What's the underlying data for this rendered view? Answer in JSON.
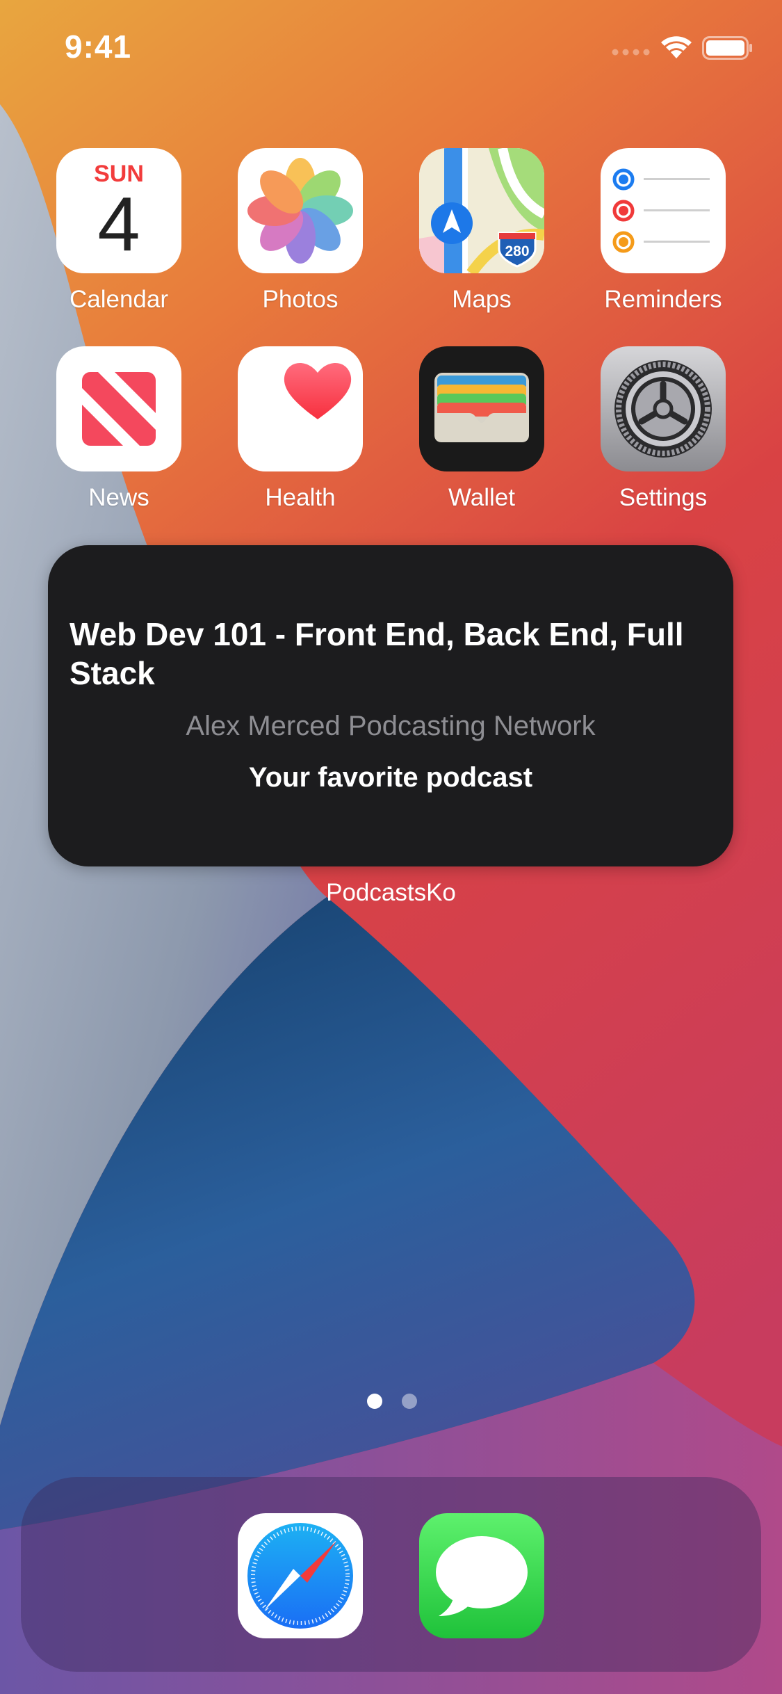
{
  "status_bar": {
    "time": "9:41"
  },
  "home_apps": [
    {
      "label": "Calendar",
      "day": "SUN",
      "date": "4"
    },
    {
      "label": "Photos"
    },
    {
      "label": "Maps",
      "shield": "280"
    },
    {
      "label": "Reminders"
    },
    {
      "label": "News"
    },
    {
      "label": "Health"
    },
    {
      "label": "Wallet"
    },
    {
      "label": "Settings"
    }
  ],
  "widget": {
    "title": "Web Dev 101 - Front End, Back End, Full Stack",
    "network": "Alex Merced Podcasting Network",
    "tagline": "Your favorite podcast",
    "app_label": "PodcastsKo"
  },
  "page_indicator": {
    "pages": 2,
    "current": 1
  },
  "dock_apps": [
    {
      "name": "safari-icon"
    },
    {
      "name": "messages-icon"
    }
  ]
}
